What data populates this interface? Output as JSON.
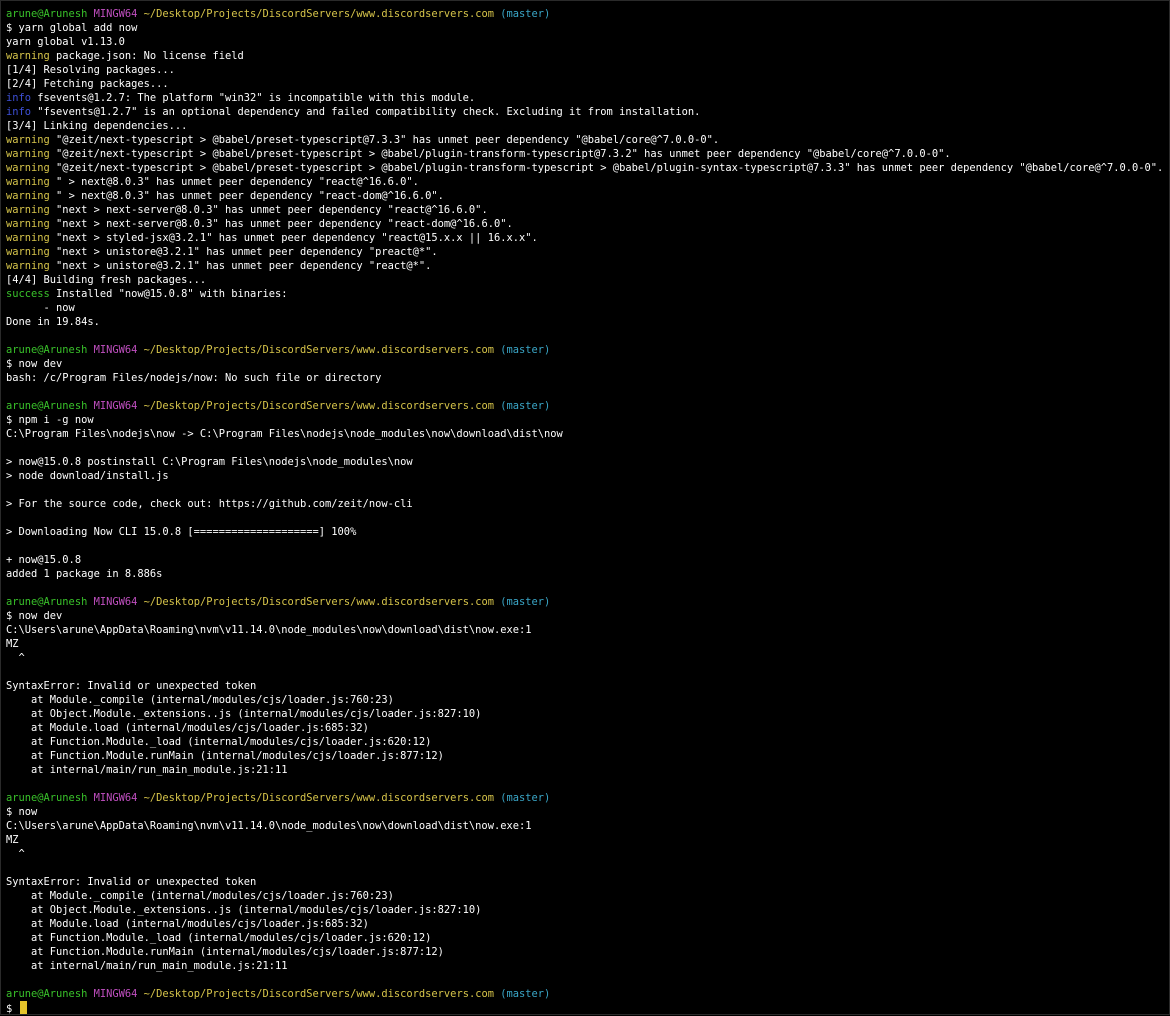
{
  "colors": {
    "background": "#000000",
    "user_host": "#39c22a",
    "shell_name": "#c04fc0",
    "path": "#d6c44a",
    "branch": "#3aa6c7",
    "warning": "#d6c44a",
    "info": "#3d4fd6",
    "success": "#39c22a",
    "text": "#ffffff",
    "cursor": "#e5c42b"
  },
  "cursor_icon": "block-cursor-icon",
  "lines": [
    {
      "kind": "prompt",
      "user": "arune@Arunesh",
      "shell": "MINGW64",
      "path": "~/Desktop/Projects/DiscordServers/www.discordservers.com",
      "branch": "(master)"
    },
    {
      "kind": "text",
      "text": "$ yarn global add now"
    },
    {
      "kind": "text",
      "text": "yarn global v1.13.0"
    },
    {
      "kind": "tagged",
      "tag": "warning",
      "text": " package.json: No license field"
    },
    {
      "kind": "text",
      "text": "[1/4] Resolving packages..."
    },
    {
      "kind": "text",
      "text": "[2/4] Fetching packages..."
    },
    {
      "kind": "tagged",
      "tag": "info",
      "text": " fsevents@1.2.7: The platform \"win32\" is incompatible with this module."
    },
    {
      "kind": "tagged",
      "tag": "info",
      "text": " \"fsevents@1.2.7\" is an optional dependency and failed compatibility check. Excluding it from installation."
    },
    {
      "kind": "text",
      "text": "[3/4] Linking dependencies..."
    },
    {
      "kind": "tagged",
      "tag": "warning",
      "text": " \"@zeit/next-typescript > @babel/preset-typescript@7.3.3\" has unmet peer dependency \"@babel/core@^7.0.0-0\"."
    },
    {
      "kind": "tagged",
      "tag": "warning",
      "text": " \"@zeit/next-typescript > @babel/preset-typescript > @babel/plugin-transform-typescript@7.3.2\" has unmet peer dependency \"@babel/core@^7.0.0-0\"."
    },
    {
      "kind": "tagged",
      "tag": "warning",
      "text": " \"@zeit/next-typescript > @babel/preset-typescript > @babel/plugin-transform-typescript > @babel/plugin-syntax-typescript@7.3.3\" has unmet peer dependency \"@babel/core@^7.0.0-0\"."
    },
    {
      "kind": "tagged",
      "tag": "warning",
      "text": " \" > next@8.0.3\" has unmet peer dependency \"react@^16.6.0\"."
    },
    {
      "kind": "tagged",
      "tag": "warning",
      "text": " \" > next@8.0.3\" has unmet peer dependency \"react-dom@^16.6.0\"."
    },
    {
      "kind": "tagged",
      "tag": "warning",
      "text": " \"next > next-server@8.0.3\" has unmet peer dependency \"react@^16.6.0\"."
    },
    {
      "kind": "tagged",
      "tag": "warning",
      "text": " \"next > next-server@8.0.3\" has unmet peer dependency \"react-dom@^16.6.0\"."
    },
    {
      "kind": "tagged",
      "tag": "warning",
      "text": " \"next > styled-jsx@3.2.1\" has unmet peer dependency \"react@15.x.x || 16.x.x\"."
    },
    {
      "kind": "tagged",
      "tag": "warning",
      "text": " \"next > unistore@3.2.1\" has unmet peer dependency \"preact@*\"."
    },
    {
      "kind": "tagged",
      "tag": "warning",
      "text": " \"next > unistore@3.2.1\" has unmet peer dependency \"react@*\"."
    },
    {
      "kind": "text",
      "text": "[4/4] Building fresh packages..."
    },
    {
      "kind": "tagged",
      "tag": "success",
      "text": " Installed \"now@15.0.8\" with binaries:"
    },
    {
      "kind": "text",
      "text": "      - now"
    },
    {
      "kind": "text",
      "text": "Done in 19.84s."
    },
    {
      "kind": "text",
      "text": ""
    },
    {
      "kind": "prompt",
      "user": "arune@Arunesh",
      "shell": "MINGW64",
      "path": "~/Desktop/Projects/DiscordServers/www.discordservers.com",
      "branch": "(master)"
    },
    {
      "kind": "text",
      "text": "$ now dev"
    },
    {
      "kind": "text",
      "text": "bash: /c/Program Files/nodejs/now: No such file or directory"
    },
    {
      "kind": "text",
      "text": ""
    },
    {
      "kind": "prompt",
      "user": "arune@Arunesh",
      "shell": "MINGW64",
      "path": "~/Desktop/Projects/DiscordServers/www.discordservers.com",
      "branch": "(master)"
    },
    {
      "kind": "text",
      "text": "$ npm i -g now"
    },
    {
      "kind": "text",
      "text": "C:\\Program Files\\nodejs\\now -> C:\\Program Files\\nodejs\\node_modules\\now\\download\\dist\\now"
    },
    {
      "kind": "text",
      "text": ""
    },
    {
      "kind": "text",
      "text": "> now@15.0.8 postinstall C:\\Program Files\\nodejs\\node_modules\\now"
    },
    {
      "kind": "text",
      "text": "> node download/install.js"
    },
    {
      "kind": "text",
      "text": ""
    },
    {
      "kind": "text",
      "text": "> For the source code, check out: https://github.com/zeit/now-cli"
    },
    {
      "kind": "text",
      "text": ""
    },
    {
      "kind": "text",
      "text": "> Downloading Now CLI 15.0.8 [====================] 100%"
    },
    {
      "kind": "text",
      "text": ""
    },
    {
      "kind": "text",
      "text": "+ now@15.0.8"
    },
    {
      "kind": "text",
      "text": "added 1 package in 8.886s"
    },
    {
      "kind": "text",
      "text": ""
    },
    {
      "kind": "prompt",
      "user": "arune@Arunesh",
      "shell": "MINGW64",
      "path": "~/Desktop/Projects/DiscordServers/www.discordservers.com",
      "branch": "(master)"
    },
    {
      "kind": "text",
      "text": "$ now dev"
    },
    {
      "kind": "text",
      "text": "C:\\Users\\arune\\AppData\\Roaming\\nvm\\v11.14.0\\node_modules\\now\\download\\dist\\now.exe:1"
    },
    {
      "kind": "text",
      "text": "MZ"
    },
    {
      "kind": "text",
      "text": "  ^"
    },
    {
      "kind": "text",
      "text": ""
    },
    {
      "kind": "text",
      "text": "SyntaxError: Invalid or unexpected token"
    },
    {
      "kind": "text",
      "text": "    at Module._compile (internal/modules/cjs/loader.js:760:23)"
    },
    {
      "kind": "text",
      "text": "    at Object.Module._extensions..js (internal/modules/cjs/loader.js:827:10)"
    },
    {
      "kind": "text",
      "text": "    at Module.load (internal/modules/cjs/loader.js:685:32)"
    },
    {
      "kind": "text",
      "text": "    at Function.Module._load (internal/modules/cjs/loader.js:620:12)"
    },
    {
      "kind": "text",
      "text": "    at Function.Module.runMain (internal/modules/cjs/loader.js:877:12)"
    },
    {
      "kind": "text",
      "text": "    at internal/main/run_main_module.js:21:11"
    },
    {
      "kind": "text",
      "text": ""
    },
    {
      "kind": "prompt",
      "user": "arune@Arunesh",
      "shell": "MINGW64",
      "path": "~/Desktop/Projects/DiscordServers/www.discordservers.com",
      "branch": "(master)"
    },
    {
      "kind": "text",
      "text": "$ now"
    },
    {
      "kind": "text",
      "text": "C:\\Users\\arune\\AppData\\Roaming\\nvm\\v11.14.0\\node_modules\\now\\download\\dist\\now.exe:1"
    },
    {
      "kind": "text",
      "text": "MZ"
    },
    {
      "kind": "text",
      "text": "  ^"
    },
    {
      "kind": "text",
      "text": ""
    },
    {
      "kind": "text",
      "text": "SyntaxError: Invalid or unexpected token"
    },
    {
      "kind": "text",
      "text": "    at Module._compile (internal/modules/cjs/loader.js:760:23)"
    },
    {
      "kind": "text",
      "text": "    at Object.Module._extensions..js (internal/modules/cjs/loader.js:827:10)"
    },
    {
      "kind": "text",
      "text": "    at Module.load (internal/modules/cjs/loader.js:685:32)"
    },
    {
      "kind": "text",
      "text": "    at Function.Module._load (internal/modules/cjs/loader.js:620:12)"
    },
    {
      "kind": "text",
      "text": "    at Function.Module.runMain (internal/modules/cjs/loader.js:877:12)"
    },
    {
      "kind": "text",
      "text": "    at internal/main/run_main_module.js:21:11"
    },
    {
      "kind": "text",
      "text": ""
    },
    {
      "kind": "prompt",
      "user": "arune@Arunesh",
      "shell": "MINGW64",
      "path": "~/Desktop/Projects/DiscordServers/www.discordservers.com",
      "branch": "(master)"
    },
    {
      "kind": "input",
      "text": "$ "
    }
  ]
}
